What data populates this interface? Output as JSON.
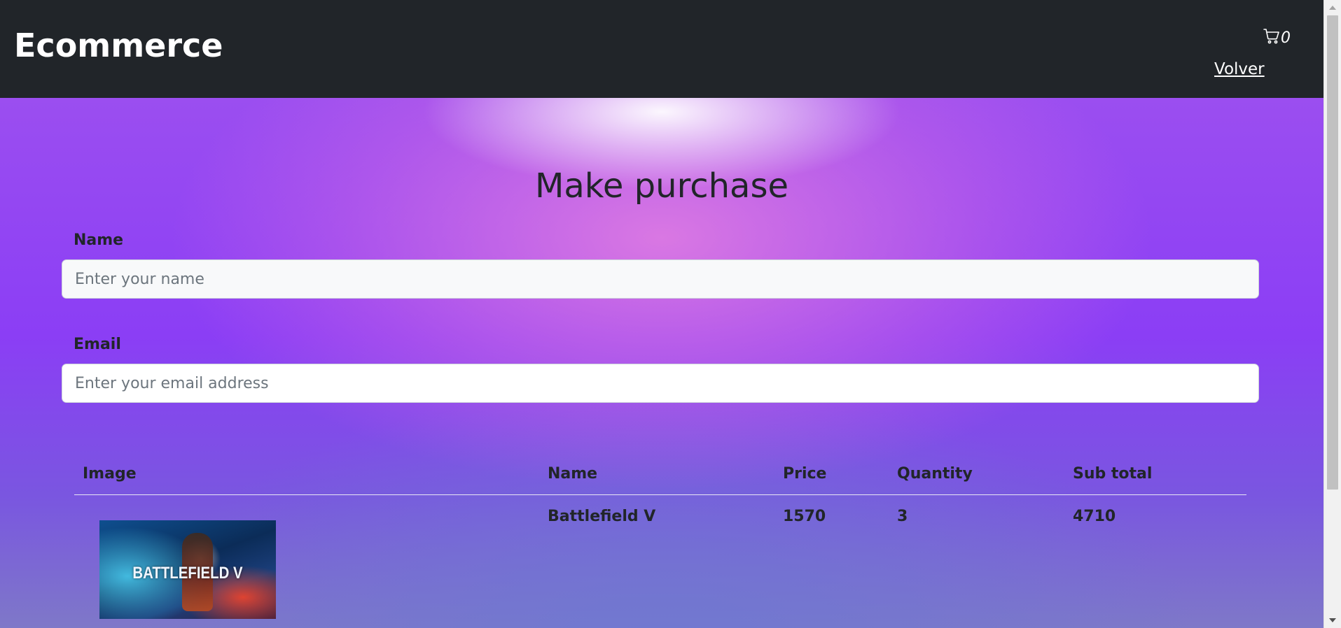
{
  "navbar": {
    "brand": "Ecommerce",
    "cart_icon": "cart-icon",
    "cart_count": "0",
    "back_link": "Volver"
  },
  "page": {
    "title": "Make purchase"
  },
  "form": {
    "name_label": "Name",
    "name_placeholder": "Enter your name",
    "email_label": "Email",
    "email_placeholder": "Enter your email address"
  },
  "table": {
    "headers": [
      "Image",
      "Name",
      "Price",
      "Quantity",
      "Sub total"
    ],
    "rows": [
      {
        "image_text": "BATTLEFIELD V",
        "name": "Battlefield V",
        "price": "1570",
        "quantity": "3",
        "subtotal": "4710"
      }
    ]
  }
}
